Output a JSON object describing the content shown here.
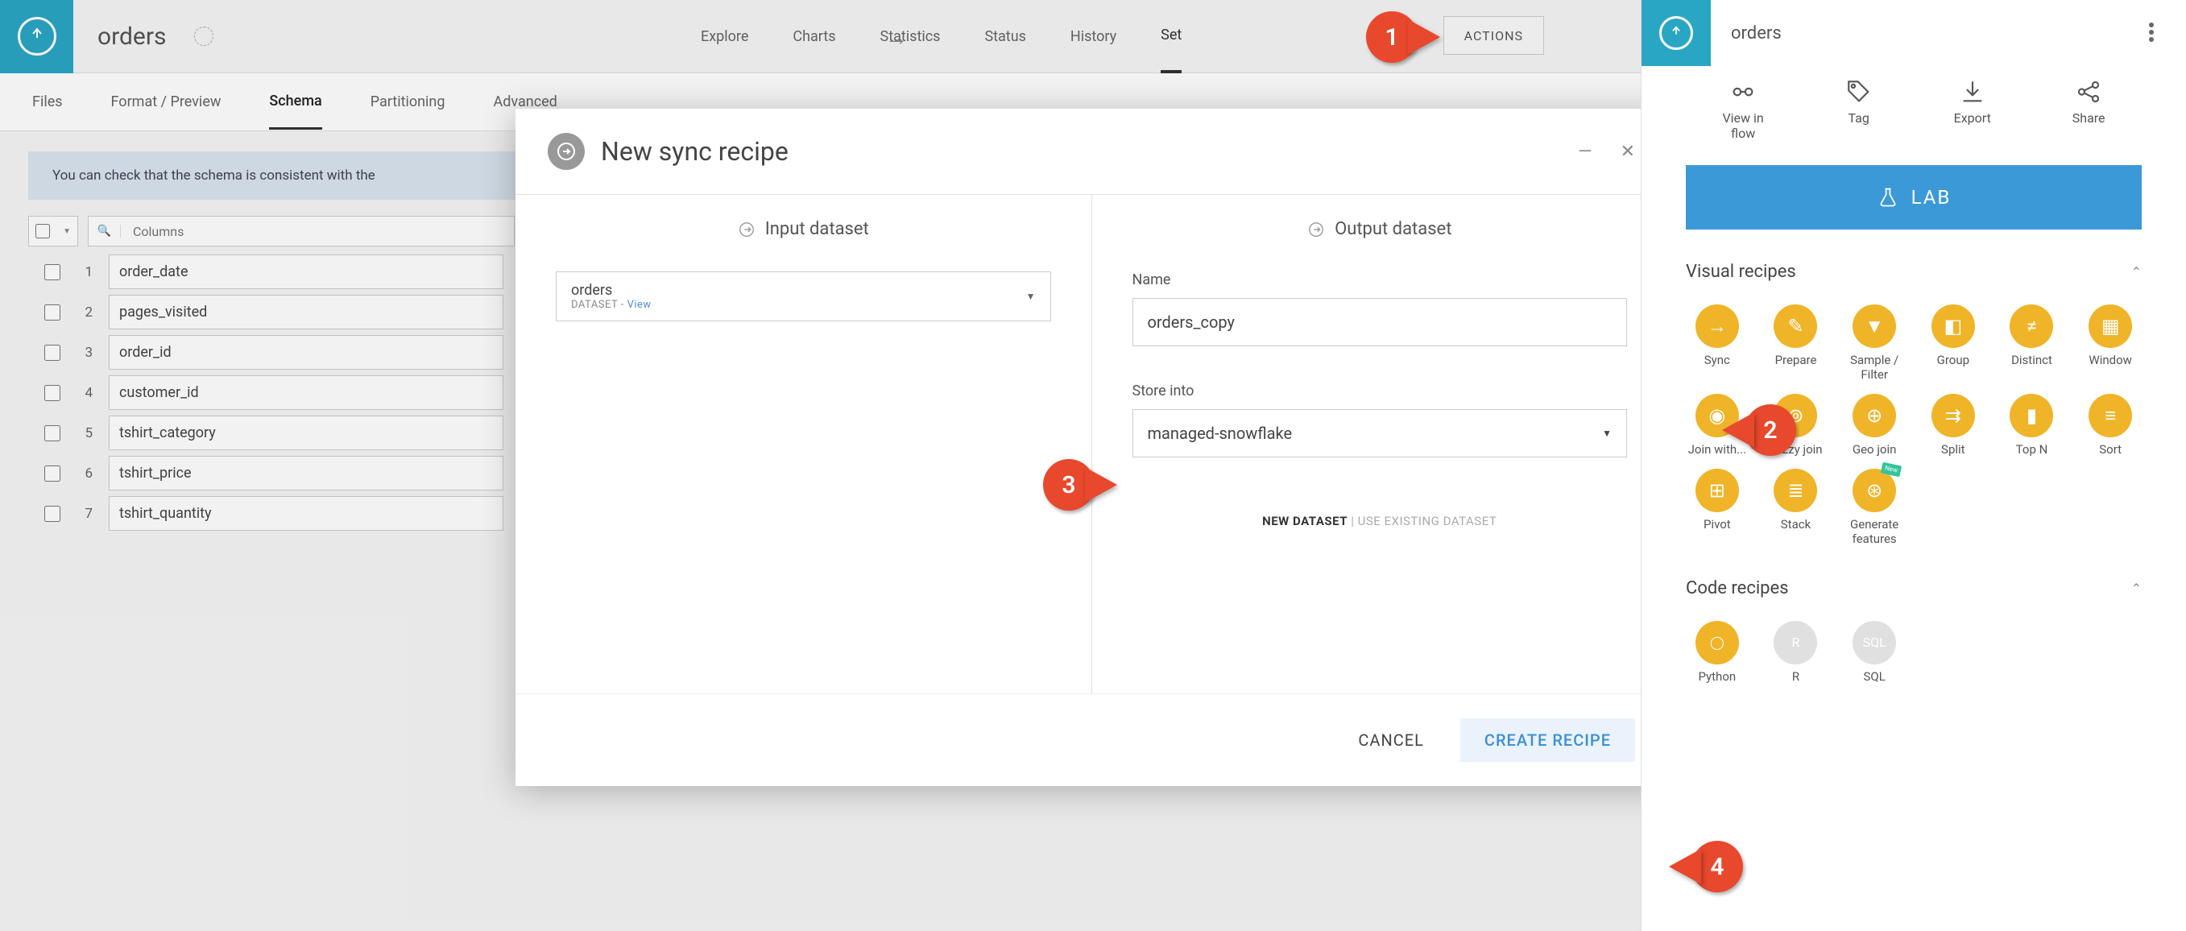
{
  "header": {
    "title": "orders",
    "nav": [
      "Explore",
      "Charts",
      "Statistics",
      "Status",
      "History",
      "Settings"
    ],
    "active_nav": "Settings",
    "actions_btn": "ACTIONS"
  },
  "subnav": {
    "items": [
      "Files",
      "Format / Preview",
      "Schema",
      "Partitioning",
      "Advanced"
    ],
    "active": "Schema"
  },
  "banner": "You can check that the schema is consistent with the",
  "columns": {
    "placeholder": "Columns",
    "rows": [
      "order_date",
      "pages_visited",
      "order_id",
      "customer_id",
      "tshirt_category",
      "tshirt_price",
      "tshirt_quantity"
    ]
  },
  "modal": {
    "title": "New sync recipe",
    "input_header": "Input dataset",
    "output_header": "Output dataset",
    "input_ds": {
      "name": "orders",
      "meta_label": "DATASET",
      "meta_sep": " - ",
      "view": "View"
    },
    "output": {
      "name_label": "Name",
      "name_value": "orders_copy",
      "store_label": "Store into",
      "store_value": "managed-snowflake",
      "toggle_new": "NEW DATASET",
      "toggle_existing": "USE EXISTING DATASET"
    },
    "cancel": "CANCEL",
    "create": "CREATE RECIPE"
  },
  "side": {
    "title": "orders",
    "actions": [
      {
        "label": "View in\nflow",
        "icon": "flow"
      },
      {
        "label": "Tag",
        "icon": "tag"
      },
      {
        "label": "Export",
        "icon": "export"
      },
      {
        "label": "Share",
        "icon": "share"
      }
    ],
    "lab": "LAB",
    "visual_header": "Visual recipes",
    "code_header": "Code recipes",
    "visual_recipes": [
      {
        "label": "Sync",
        "g": "→"
      },
      {
        "label": "Prepare",
        "g": "✎"
      },
      {
        "label": "Sample / Filter",
        "g": "▼"
      },
      {
        "label": "Group",
        "g": "◧"
      },
      {
        "label": "Distinct",
        "g": "≠"
      },
      {
        "label": "Window",
        "g": "▦"
      },
      {
        "label": "Join with...",
        "g": "◉"
      },
      {
        "label": "Fuzzy join",
        "g": "⊚"
      },
      {
        "label": "Geo join",
        "g": "⊕"
      },
      {
        "label": "Split",
        "g": "⇉"
      },
      {
        "label": "Top N",
        "g": "▮"
      },
      {
        "label": "Sort",
        "g": "≡"
      },
      {
        "label": "Pivot",
        "g": "⊞"
      },
      {
        "label": "Stack",
        "g": "≣"
      },
      {
        "label": "Generate features",
        "g": "⊛",
        "new": true
      }
    ],
    "code_recipes": [
      {
        "label": "Python",
        "g": "◯"
      },
      {
        "label": "R",
        "g": "R"
      },
      {
        "label": "SQL",
        "g": "SQL"
      }
    ]
  },
  "annotations": {
    "a1": "1",
    "a2": "2",
    "a3": "3",
    "a4": "4"
  }
}
